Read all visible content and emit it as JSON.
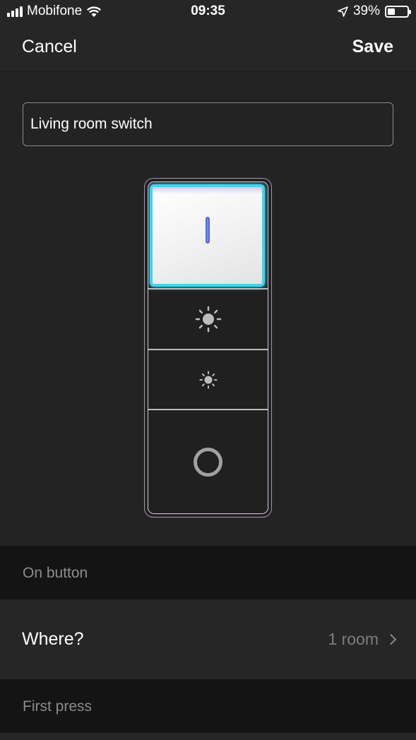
{
  "status_bar": {
    "carrier": "Mobifone",
    "time": "09:35",
    "battery_percent": "39%",
    "battery_level": 0.39
  },
  "nav": {
    "cancel_label": "Cancel",
    "save_label": "Save"
  },
  "switch_name": {
    "value": "Living room switch"
  },
  "remote": {
    "selected_button": "on",
    "accent_color": "#3fd4ee"
  },
  "sections": {
    "on_button_header": "On button",
    "where_label": "Where?",
    "where_value": "1 room",
    "first_press_header": "First press"
  }
}
